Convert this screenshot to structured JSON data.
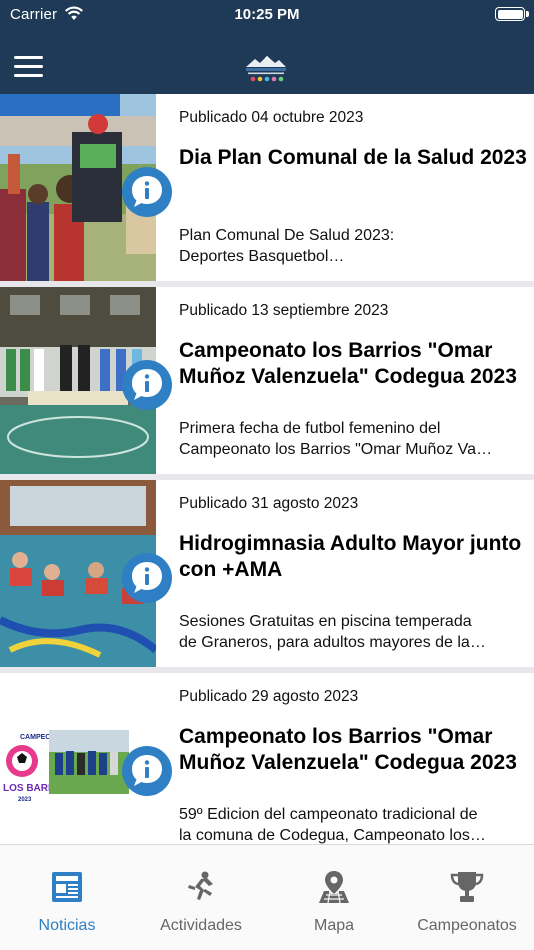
{
  "status_bar": {
    "carrier": "Carrier",
    "time": "10:25 PM"
  },
  "nav": {
    "menu_icon": "hamburger-menu-icon",
    "logo": "app-logo"
  },
  "news": [
    {
      "date": "Publicado 04 octubre 2023",
      "title": "Dia Plan Comunal de la Salud 2023",
      "excerpt_line1": "Plan Comunal De Salud 2023:",
      "excerpt_line2": "Deportes Basquetbol…"
    },
    {
      "date": "Publicado 13 septiembre 2023",
      "title": "Campeonato los Barrios \"Omar Muñoz Valenzuela\" Codegua 2023",
      "excerpt_line1": "Primera fecha de futbol femenino del",
      "excerpt_line2": "Campeonato los Barrios \"Omar Muñoz Va…"
    },
    {
      "date": "Publicado 31 agosto 2023",
      "title": "Hidrogimnasia Adulto Mayor junto con +AMA",
      "excerpt_line1": "Sesiones Gratuitas en piscina temperada",
      "excerpt_line2": "de Graneros, para adultos mayores de la…"
    },
    {
      "date": "Publicado 29 agosto 2023",
      "title": "Campeonato los Barrios \"Omar Muñoz Valenzuela\" Codegua 2023",
      "excerpt_line1": "59º Edicion del campeonato tradicional de",
      "excerpt_line2": "la comuna de Codegua, Campeonato los…",
      "thumb_text_top": "CAMPEONATO",
      "thumb_text_main": "LOS BARRIOS",
      "thumb_text_year": "2023"
    }
  ],
  "tabs": [
    {
      "label": "Noticias",
      "icon": "newspaper-icon",
      "active": true
    },
    {
      "label": "Actividades",
      "icon": "runner-icon",
      "active": false
    },
    {
      "label": "Mapa",
      "icon": "map-pin-icon",
      "active": false
    },
    {
      "label": "Campeonatos",
      "icon": "trophy-icon",
      "active": false
    }
  ],
  "colors": {
    "header": "#1f3a56",
    "accent": "#2e7fc3",
    "inactive_tab": "#666666",
    "separator": "#e8e8ec"
  }
}
